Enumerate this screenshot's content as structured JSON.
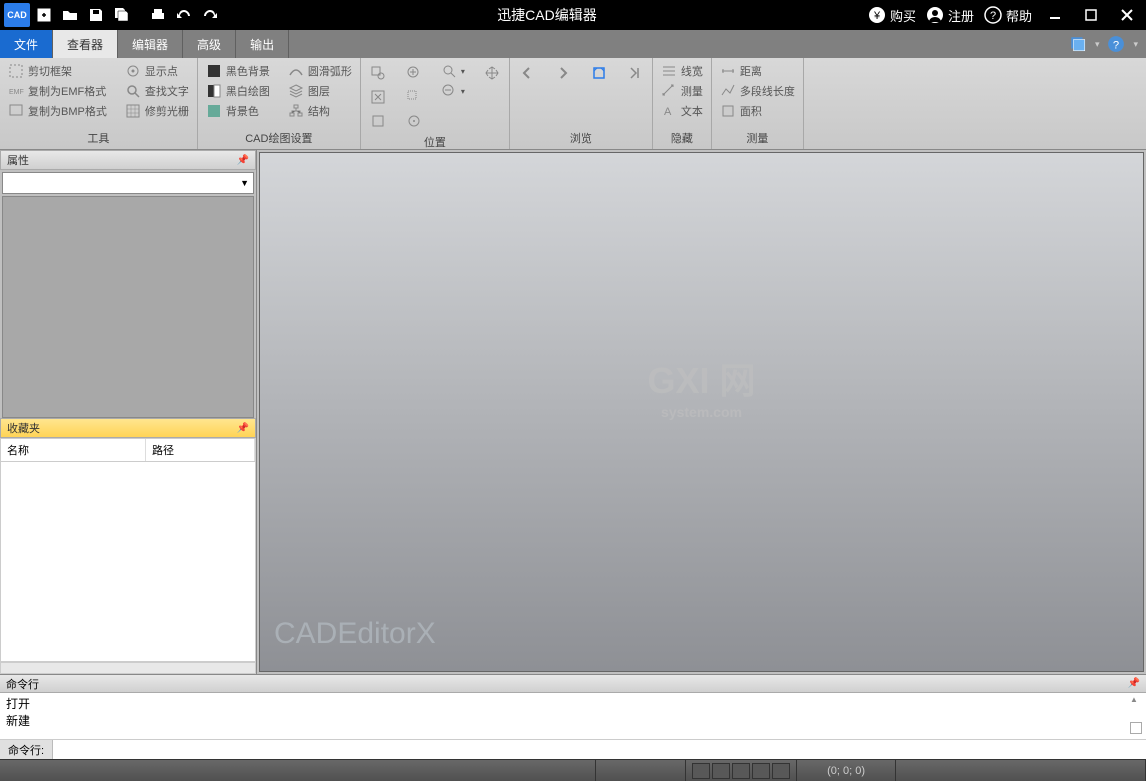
{
  "titlebar": {
    "app_icon_text": "CAD",
    "title": "迅捷CAD编辑器",
    "buy": "购买",
    "register": "注册",
    "help": "帮助"
  },
  "menu": {
    "file": "文件",
    "viewer": "查看器",
    "editor": "编辑器",
    "advanced": "高级",
    "output": "输出"
  },
  "ribbon": {
    "tools": {
      "label": "工具",
      "cut_frame": "剪切框架",
      "copy_emf": "复制为EMF格式",
      "copy_bmp": "复制为BMP格式",
      "show_point": "显示点",
      "find_text": "查找文字",
      "fix_raster": "修剪光栅"
    },
    "cad_settings": {
      "label": "CAD绘图设置",
      "black_bg": "黑色背景",
      "bw_draw": "黑白绘图",
      "bg_color": "背景色",
      "smooth_arc": "圆滑弧形",
      "layer": "图层",
      "structure": "结构"
    },
    "position": {
      "label": "位置"
    },
    "browse": {
      "label": "浏览"
    },
    "hide": {
      "label": "隐藏",
      "lineweight": "线宽",
      "measure": "测量",
      "text": "文本"
    },
    "measure": {
      "label": "测量",
      "distance": "距离",
      "polyline_len": "多段线长度",
      "area": "面积"
    }
  },
  "panels": {
    "properties": "属性",
    "favorites": "收藏夹",
    "fav_col_name": "名称",
    "fav_col_path": "路径"
  },
  "canvas": {
    "watermark1": "GXI 网",
    "watermark2": "system.com",
    "label": "CADEditorX"
  },
  "cmdline": {
    "header": "命令行",
    "history1": "打开",
    "history2": "新建",
    "prompt": "命令行:"
  },
  "statusbar": {
    "coords": "(0; 0; 0)"
  }
}
